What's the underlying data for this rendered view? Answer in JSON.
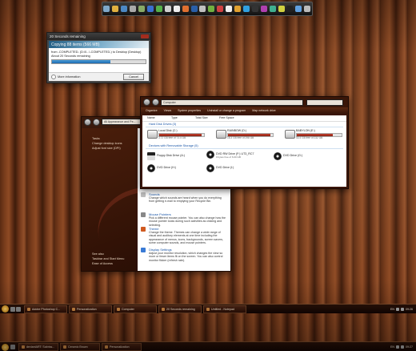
{
  "dock": {
    "icons": [
      "computer-icon",
      "folder-icon",
      "network-icon",
      "settings-icon",
      "recycle-icon",
      "browser-icon",
      "messenger-icon",
      "mail-icon",
      "clock-icon",
      "music-icon",
      "photoshop-icon",
      "cd-icon",
      "torrent-icon",
      "calendar-icon",
      "notepad-icon",
      "media-player-icon",
      "skype-icon",
      "steam-icon",
      "game-icon",
      "chart-icon",
      "search-icon",
      "terminal-icon",
      "weather-icon",
      "trash-icon"
    ],
    "colors": [
      "#7fa8c9",
      "#e0b040",
      "#4c88c4",
      "#aaaaaa",
      "#88aa66",
      "#3a6fd0",
      "#55b04a",
      "#d0d0d0",
      "#eeeeee",
      "#e07030",
      "#2a5fa8",
      "#c0c0c0",
      "#70b040",
      "#d04040",
      "#f0f0f0",
      "#e0a030",
      "#30a0e0",
      "#333333",
      "#b040b0",
      "#40b090",
      "#d0d040",
      "#222222",
      "#60a0e0",
      "#bbbbbb"
    ]
  },
  "copy_dialog": {
    "title": "20 Seconds remaining",
    "heading": "Copying 88 items (566 MB)",
    "from_line": "from -COMPLETED- (D:\\0...\\-COMPLETED-) to Desktop (Desktop)",
    "time_line": "About 20 Seconds remaining",
    "progress": 0.62,
    "more_info": "More information",
    "cancel": "Cancel"
  },
  "control_panel": {
    "address": "All Appearance and Pe...",
    "side_tasks": [
      "Tasks",
      "Change desktop icons",
      "Adjust font size (DPI)"
    ],
    "side_bottom": [
      "See also",
      "Taskbar and Start Menu",
      "Ease of Access"
    ],
    "items": [
      {
        "title": "Sounds",
        "desc": "Change which sounds are heard when you do everything from getting e-mail to emptying your Recycle Bin.",
        "color": "#c0c0c0"
      },
      {
        "title": "Mouse Pointers",
        "desc": "Pick a different mouse pointer. You can also change how the mouse pointer looks during such activities as clicking and selecting.",
        "color": "#888888"
      },
      {
        "title": "Theme",
        "desc": "Change the theme. Themes can change a wide range of visual and auditory elements at one time including the appearance of menus, icons, backgrounds, screen savers, some computer sounds, and mouse pointers.",
        "color": "#d05a20"
      },
      {
        "title": "Display Settings",
        "desc": "Adjust your monitor resolution, which changes the view so more or fewer items fit on the screen. You can also control monitor flicker (refresh rate).",
        "color": "#3a7bd5"
      }
    ]
  },
  "computer_window": {
    "address": "Computer",
    "toolbar": [
      "Organize",
      "Views",
      "System properties",
      "Uninstall or change a program",
      "Map network drive"
    ],
    "headers": [
      "Name",
      "Type",
      "Total Size",
      "Free Space"
    ],
    "hdd_group": "Hard Disk Drives (3)",
    "hard_drives": [
      {
        "name": "Local Disk (C:)",
        "free": "3.72 GB free of 73.4 GB",
        "used": 0.95
      },
      {
        "name": "RAINBOW (D:)",
        "free": "18.3 GB free of 298 GB",
        "used": 0.94
      },
      {
        "name": "BABYLON (E:)",
        "free": "43.4 GB free of 232 GB",
        "used": 0.81
      }
    ],
    "removable_group": "Devices with Removable Storage (5)",
    "removable": [
      {
        "name": "Floppy Disk Drive (A:)",
        "sub": "",
        "type": "floppy"
      },
      {
        "name": "DVD RW Drive (F:) UT3_RC7",
        "sub": "0 bytes free of 6.00 GB",
        "type": "disc"
      },
      {
        "name": "DVD Drive (G:)",
        "sub": "",
        "type": "disc"
      },
      {
        "name": "DVD Drive (H:)",
        "sub": "",
        "type": "disc"
      },
      {
        "name": "DVD Drive (I:)",
        "sub": "",
        "type": "disc"
      }
    ]
  },
  "taskbar_main": {
    "buttons": [
      "Adobe Photoshop C...",
      "Personalization",
      "Computer",
      "20 Seconds remaining",
      "Untitled - Notepad"
    ],
    "tray_label": "EN",
    "clock": "09:26"
  },
  "taskbar_second": {
    "buttons": [
      "deviantART: Sabriss...",
      "Ceramic Brown",
      "Personalization"
    ],
    "tray_label": "EN",
    "clock": "09:27"
  }
}
